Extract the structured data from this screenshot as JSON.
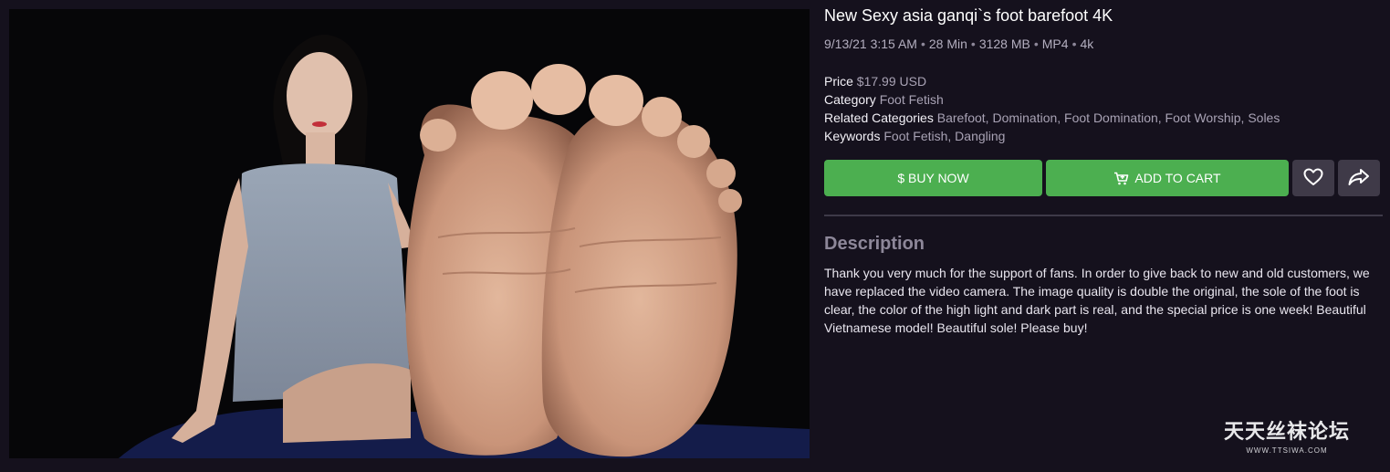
{
  "product": {
    "title": "New Sexy asia ganqi`s foot barefoot 4K",
    "meta": [
      "9/13/21 3:15 AM",
      "28 Min",
      "3128 MB",
      "MP4",
      "4k"
    ],
    "meta_separator": "•",
    "details": {
      "price_label": "Price",
      "price_value": "$17.99 USD",
      "category_label": "Category",
      "category_value": "Foot Fetish",
      "related_label": "Related Categories",
      "related_value": "Barefoot, Domination, Foot Domination, Foot Worship, Soles",
      "keywords_label": "Keywords",
      "keywords_value": "Foot Fetish, Dangling"
    }
  },
  "actions": {
    "buy_label": "$ BUY NOW",
    "cart_label": "ADD TO CART",
    "favorite_icon": "heart-icon",
    "share_icon": "share-icon",
    "accent_color": "#4caf50"
  },
  "description": {
    "heading": "Description",
    "text": "Thank you very much for the support of fans. In order to give back to new and old customers, we have replaced the video camera. The image quality is double the original, the sole of the foot is clear, the color of the high light and dark part is real, and the special price is one week! Beautiful Vietnamese model! Beautiful sole! Please buy!"
  },
  "watermark": {
    "chinese": "天天丝袜论坛",
    "url": "WWW.TTSIWA.COM"
  },
  "colors": {
    "background": "#15111d",
    "button_secondary": "#3f3a48",
    "muted_text": "#a8a2b4"
  }
}
